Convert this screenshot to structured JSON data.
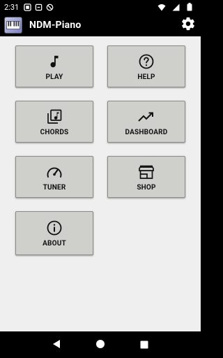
{
  "status_bar": {
    "time": "2:31",
    "icons": [
      "signal-icon",
      "notification-icon",
      "blocked-icon",
      "wifi-icon",
      "cell-signal-icon",
      "battery-icon"
    ]
  },
  "app_bar": {
    "title": "NDM-Piano",
    "logo": "piano-keyboard-logo",
    "settings_icon": "gear-icon"
  },
  "menu": {
    "play": {
      "label": "PLAY",
      "icon": "music-note-icon"
    },
    "help": {
      "label": "HELP",
      "icon": "help-circle-icon"
    },
    "chords": {
      "label": "CHORDS",
      "icon": "music-library-icon"
    },
    "dashboard": {
      "label": "DASHBOARD",
      "icon": "trending-up-icon"
    },
    "tuner": {
      "label": "TUNER",
      "icon": "speedometer-icon"
    },
    "shop": {
      "label": "SHOP",
      "icon": "store-icon"
    },
    "about": {
      "label": "ABOUT",
      "icon": "info-circle-icon"
    }
  },
  "nav_bar": {
    "back": "back-triangle-icon",
    "home": "home-circle-icon",
    "recents": "recents-square-icon"
  },
  "colors": {
    "status_bar": "#000000",
    "app_bar": "#000000",
    "background": "#efefef",
    "tile": "#cfcfcb",
    "tile_border": "#8a8a88",
    "text": "#111111"
  }
}
